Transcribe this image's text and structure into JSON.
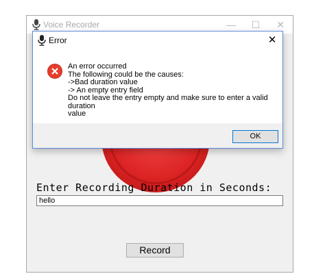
{
  "main_window": {
    "title": "Voice Recorder",
    "controls": {
      "minimize": "—",
      "maximize": "☐",
      "close": "✕"
    },
    "duration_label": "Enter Recording Duration in Seconds:",
    "duration_input": {
      "value": "hello"
    },
    "record_button": "Record",
    "accent_color": "#dd2424"
  },
  "dialog": {
    "title": "Error",
    "close": "✕",
    "icon": "error-icon",
    "message_lines": [
      "An error occurred",
      "The following could be the causes:",
      "->Bad duration value",
      "-> An empty entry field",
      "Do not leave the entry empty and make sure to enter a valid duration",
      "value"
    ],
    "ok_button": "OK"
  }
}
